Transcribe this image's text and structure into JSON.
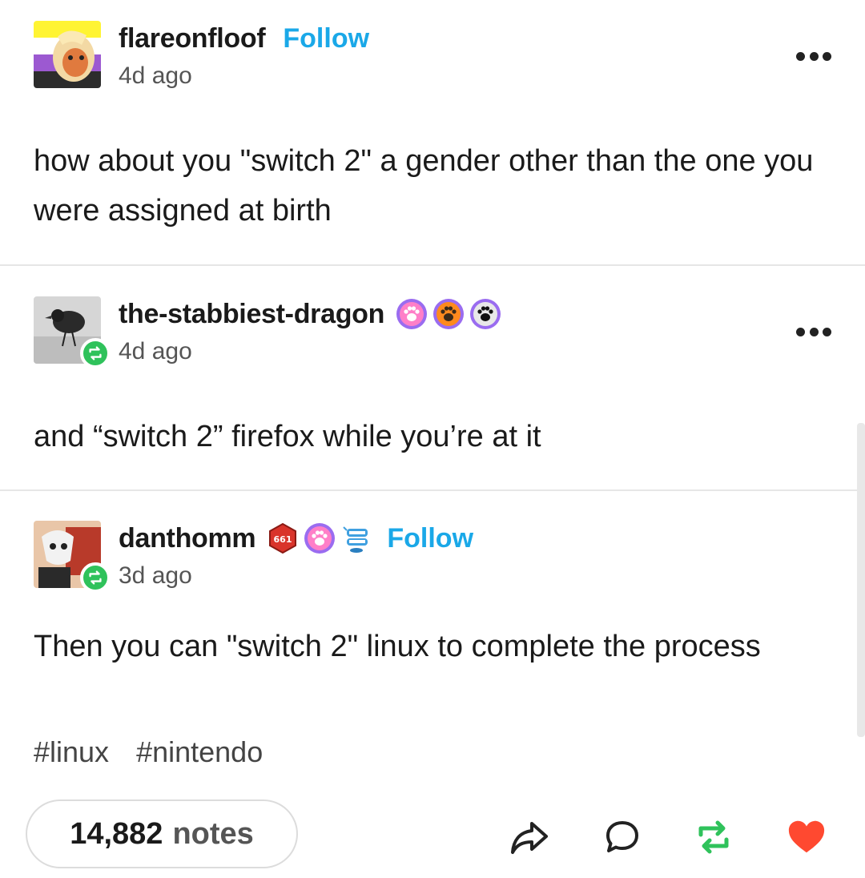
{
  "posts": [
    {
      "username": "flareonfloof",
      "follow_label": "Follow",
      "time": "4d ago",
      "text": "how about you \"switch 2\" a gender other than the one you were assigned at birth"
    },
    {
      "username": "the-stabbiest-dragon",
      "time": "4d ago",
      "text": "and “switch 2” firefox while you’re at it",
      "badges": [
        "pink-paw-badge",
        "orange-paw-badge",
        "black-paw-badge"
      ]
    },
    {
      "username": "danthomm",
      "follow_label": "Follow",
      "time": "3d ago",
      "badge_text": "661",
      "text": "Then you can \"switch 2\" linux to complete the process",
      "tags": [
        "#linux",
        "#nintendo"
      ]
    }
  ],
  "footer": {
    "notes_count": "14,882",
    "notes_word": "notes"
  },
  "colors": {
    "follow": "#1aa8e8",
    "reblog": "#2fc25b",
    "like": "#ff4930"
  }
}
